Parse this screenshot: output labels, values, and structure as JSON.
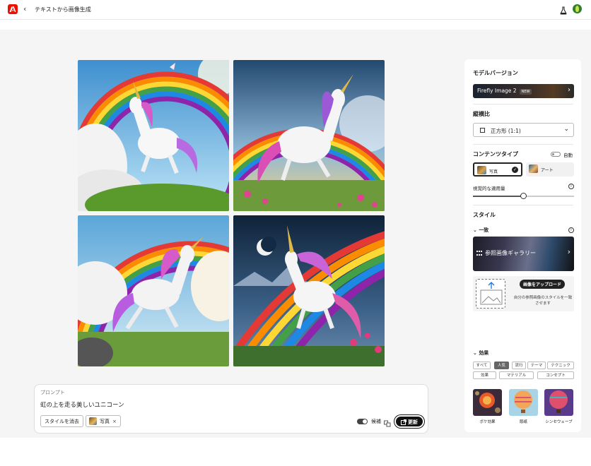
{
  "header": {
    "back_icon": "‹",
    "title": "テキストから画像生成"
  },
  "prompt": {
    "label": "プロンプト",
    "text": "虹の上を走る美しいユニコーン",
    "clear_style": "スタイルを消去",
    "style_chip": "写真",
    "style_chip_close": "×",
    "candidates_label": "候補",
    "generate_label": "更新"
  },
  "panel": {
    "model_version_title": "モデルバージョン",
    "model_name": "Firefly Image 2",
    "model_badge": "NEW",
    "aspect_title": "縦横比",
    "aspect_value": "正方形 (1:1)",
    "content_type_title": "コンテンツタイプ",
    "auto_label": "自動",
    "content_photo": "写真",
    "content_art": "アート",
    "visual_intensity_label": "視覚的な適用量",
    "visual_intensity_value": 0.5,
    "style_title": "スタイル",
    "match_title": "一致",
    "gallery_label": "参照画像ギャラリー",
    "upload_button": "画像をアップロード",
    "upload_hint": "自分の参照画像のスタイルを一致させます",
    "effects_title": "効果",
    "effect_tags_row1": [
      "すべて",
      "人気",
      "流行",
      "テーマ",
      "テクニック"
    ],
    "effect_tags_row2": [
      "効果",
      "マテリアル",
      "コンセプト"
    ],
    "active_tag": "人気",
    "effects": [
      "ボケ効果",
      "彫紙",
      "シンセウェーブ"
    ]
  },
  "colors": {
    "brand_red": "#eb1000",
    "primary_dark": "#111111",
    "panel_bg": "#ffffff",
    "canvas_bg": "#f5f5f5"
  }
}
